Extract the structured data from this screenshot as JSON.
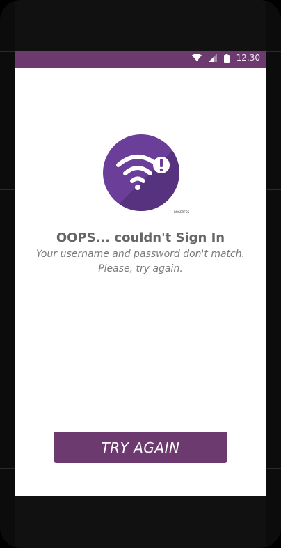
{
  "status_bar": {
    "time": "12.30",
    "wifi_icon": "wifi-icon",
    "signal_icon": "signal-icon",
    "battery_icon": "battery-icon",
    "bar_color": "#6c3a6e"
  },
  "hero": {
    "icon": "wifi-error-icon",
    "circle_color": "#6b3e9a",
    "tiny_label": "ROGERFOS"
  },
  "content": {
    "title": "OOPS... couldn't Sign In",
    "message_line1": "Your username and password don't match.",
    "message_line2": "Please, try again."
  },
  "actions": {
    "try_again_label": "TRY AGAIN",
    "button_color": "#6c3a6e"
  }
}
